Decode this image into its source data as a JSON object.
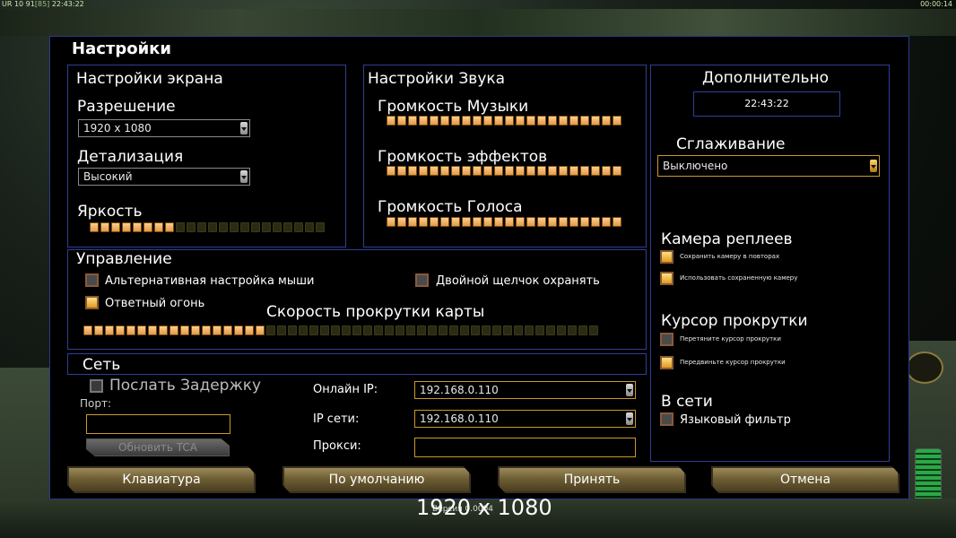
{
  "hud": {
    "left_prefix": "UR 10 91",
    "left_bracket": "[85]",
    "left_time": "22:43:22",
    "right_time": "00:00:14"
  },
  "dialog": {
    "title": "Настройки"
  },
  "screen": {
    "title": "Настройки экрана",
    "resolution_label": "Разрешение",
    "resolution_value": "1920 x 1080",
    "detail_label": "Детализация",
    "detail_value": "Высокий",
    "brightness_label": "Яркость",
    "brightness_level": "8/22"
  },
  "sound": {
    "title": "Настройки Звука",
    "music_label": "Громкость Музыки",
    "music_level": "22/22",
    "effects_label": "Громкость эффектов",
    "effects_level": "22/22",
    "voice_label": "Громкость Голоса",
    "voice_level": "22/22"
  },
  "extra": {
    "title": "Дополнительно",
    "clock": "22:43:22",
    "antialias_label": "Сглаживание",
    "antialias_value": "Выключено",
    "replay_camera_title": "Камера реплеев",
    "replay_opt1": "Сохранить камеру в повторах",
    "replay_opt2": "Использовать сохраненную камеру",
    "scroll_cursor_title": "Курсор прокрутки",
    "scroll_opt1": "Перетяните курсор прокрутки",
    "scroll_opt2": "Передвиньте курсор прокрутки",
    "online_title": "В сети",
    "language_filter": "Языковый фильтр"
  },
  "controls": {
    "title": "Управление",
    "alt_mouse": "Альтернативная настройка мыши",
    "double_click": "Двойной щелчок охранять",
    "return_fire": "Ответный огонь",
    "scroll_speed_label": "Скорость прокрутки карты",
    "scroll_speed_level": "17/48"
  },
  "network": {
    "title": "Сеть",
    "send_delay": "Послать Задержку",
    "port_label": "Порт:",
    "port_value": "",
    "update_tca": "Обновить TCA",
    "online_ip_label": "Онлайн IP:",
    "online_ip_value": "192.168.0.110",
    "lan_ip_label": "IP сети:",
    "lan_ip_value": "192.168.0.110",
    "proxy_label": "Прокси:",
    "proxy_value": ""
  },
  "buttons": {
    "keyboard": "Клавиатура",
    "defaults": "По умолчанию",
    "accept": "Принять",
    "cancel": "Отмена"
  },
  "overlay": {
    "resolution": "1920 x 1080",
    "version": "Версия 0.0004"
  }
}
